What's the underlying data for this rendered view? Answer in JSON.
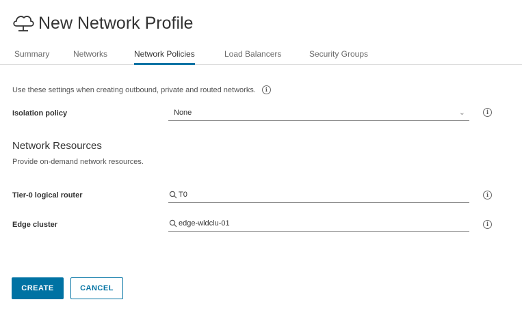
{
  "header": {
    "title": "New Network Profile",
    "icon": "cloud-icon"
  },
  "tabs": [
    {
      "label": "Summary",
      "active": false
    },
    {
      "label": "Networks",
      "active": false
    },
    {
      "label": "Network Policies",
      "active": true
    },
    {
      "label": "Load Balancers",
      "active": false
    },
    {
      "label": "Security Groups",
      "active": false
    }
  ],
  "policies": {
    "description": "Use these settings when creating outbound, private and routed networks.",
    "isolation_policy": {
      "label": "Isolation policy",
      "value": "None"
    }
  },
  "network_resources": {
    "title": "Network Resources",
    "subtitle": "Provide on-demand network resources.",
    "tier0_router": {
      "label": "Tier-0 logical router",
      "value": "T0"
    },
    "edge_cluster": {
      "label": "Edge cluster",
      "value": "edge-wldclu-01"
    }
  },
  "actions": {
    "create_label": "CREATE",
    "cancel_label": "CANCEL"
  },
  "colors": {
    "accent": "#0072a3"
  }
}
